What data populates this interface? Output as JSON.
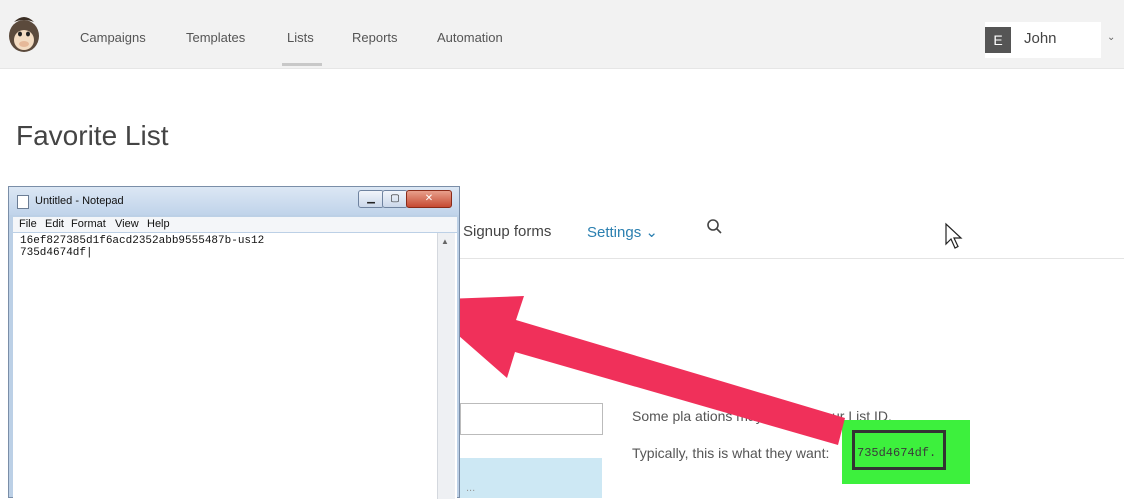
{
  "nav": {
    "items": [
      "Campaigns",
      "Templates",
      "Lists",
      "Reports",
      "Automation"
    ],
    "active": "Lists",
    "user_initial": "E",
    "user_name": "John",
    "caret": "⌄"
  },
  "page": {
    "title": "Favorite List"
  },
  "subnav": {
    "signup_forms": "Signup forms",
    "settings": "Settings ⌄"
  },
  "content": {
    "info_line1": "Some pla          ations may request your List ID.",
    "info_line2": "Typically, this is what they want:",
    "list_id": "735d4674df.",
    "blue_box_text": "..."
  },
  "notepad": {
    "title": "Untitled - Notepad",
    "menu": [
      "File",
      "Edit",
      "Format",
      "View",
      "Help"
    ],
    "lines": [
      "16ef827385d1f6acd2352abb9555487b-us12",
      "735d4674df|"
    ]
  },
  "colors": {
    "accent_link": "#2a7fb0",
    "highlight": "#3df03d",
    "arrow": "#f0305a"
  }
}
